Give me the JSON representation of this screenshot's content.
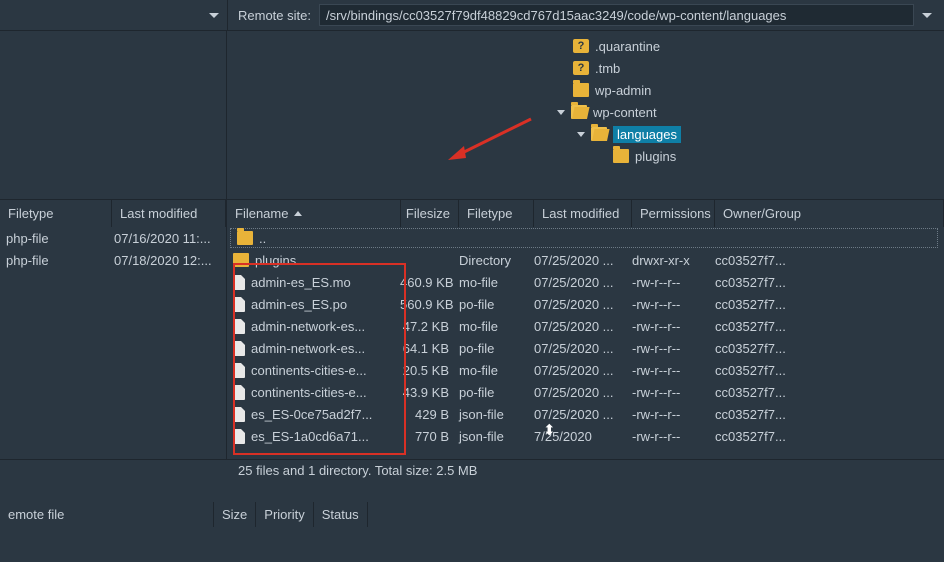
{
  "remoteSite": {
    "label": "Remote site:",
    "path": "/srv/bindings/cc03527f79df48829cd767d15aac3249/code/wp-content/languages"
  },
  "tree": {
    "nodes": [
      {
        "depth": 0,
        "icon": "q",
        "label": ".quarantine"
      },
      {
        "depth": 0,
        "icon": "q",
        "label": ".tmb"
      },
      {
        "depth": 0,
        "icon": "folder",
        "label": "wp-admin"
      },
      {
        "depth": 0,
        "icon": "folder-open",
        "expander": "expanded",
        "label": "wp-content"
      },
      {
        "depth": 1,
        "icon": "folder-open",
        "expander": "expanded",
        "label": "languages",
        "selected": true
      },
      {
        "depth": 2,
        "icon": "folder",
        "label": "plugins"
      }
    ]
  },
  "leftHeaders": {
    "filetype": "Filetype",
    "modified": "Last modified"
  },
  "rightHeaders": {
    "filename": "Filename",
    "filesize": "Filesize",
    "filetype": "Filetype",
    "modified": "Last modified",
    "permissions": "Permissions",
    "owner": "Owner/Group"
  },
  "leftFiles": [
    {
      "type": "php-file",
      "modified": "07/16/2020 11:..."
    },
    {
      "type": "php-file",
      "modified": "07/18/2020 12:..."
    }
  ],
  "parentLabel": "..",
  "rightFiles": [
    {
      "name": "plugins",
      "size": "",
      "type": "Directory",
      "modified": "07/25/2020 ...",
      "perm": "drwxr-xr-x",
      "owner": "cc03527f7...",
      "icon": "folder"
    },
    {
      "name": "admin-es_ES.mo",
      "size": "460.9 KB",
      "type": "mo-file",
      "modified": "07/25/2020 ...",
      "perm": "-rw-r--r--",
      "owner": "cc03527f7...",
      "icon": "file"
    },
    {
      "name": "admin-es_ES.po",
      "size": "560.9 KB",
      "type": "po-file",
      "modified": "07/25/2020 ...",
      "perm": "-rw-r--r--",
      "owner": "cc03527f7...",
      "icon": "file"
    },
    {
      "name": "admin-network-es...",
      "size": "47.2 KB",
      "type": "mo-file",
      "modified": "07/25/2020 ...",
      "perm": "-rw-r--r--",
      "owner": "cc03527f7...",
      "icon": "file"
    },
    {
      "name": "admin-network-es...",
      "size": "64.1 KB",
      "type": "po-file",
      "modified": "07/25/2020 ...",
      "perm": "-rw-r--r--",
      "owner": "cc03527f7...",
      "icon": "file"
    },
    {
      "name": "continents-cities-e...",
      "size": "20.5 KB",
      "type": "mo-file",
      "modified": "07/25/2020 ...",
      "perm": "-rw-r--r--",
      "owner": "cc03527f7...",
      "icon": "file"
    },
    {
      "name": "continents-cities-e...",
      "size": "43.9 KB",
      "type": "po-file",
      "modified": "07/25/2020 ...",
      "perm": "-rw-r--r--",
      "owner": "cc03527f7...",
      "icon": "file"
    },
    {
      "name": "es_ES-0ce75ad2f7...",
      "size": "429 B",
      "type": "json-file",
      "modified": "07/25/2020 ...",
      "perm": "-rw-r--r--",
      "owner": "cc03527f7...",
      "icon": "file"
    },
    {
      "name": "es_ES-1a0cd6a71...",
      "size": "770 B",
      "type": "json-file",
      "modified": "7/25/2020",
      "perm": "-rw-r--r--",
      "owner": "cc03527f7...",
      "icon": "file"
    }
  ],
  "statusText": "25 files and 1 directory. Total size: 2.5 MB",
  "bottomHeaders": {
    "remotefile": "emote file",
    "size": "Size",
    "priority": "Priority",
    "status": "Status"
  }
}
